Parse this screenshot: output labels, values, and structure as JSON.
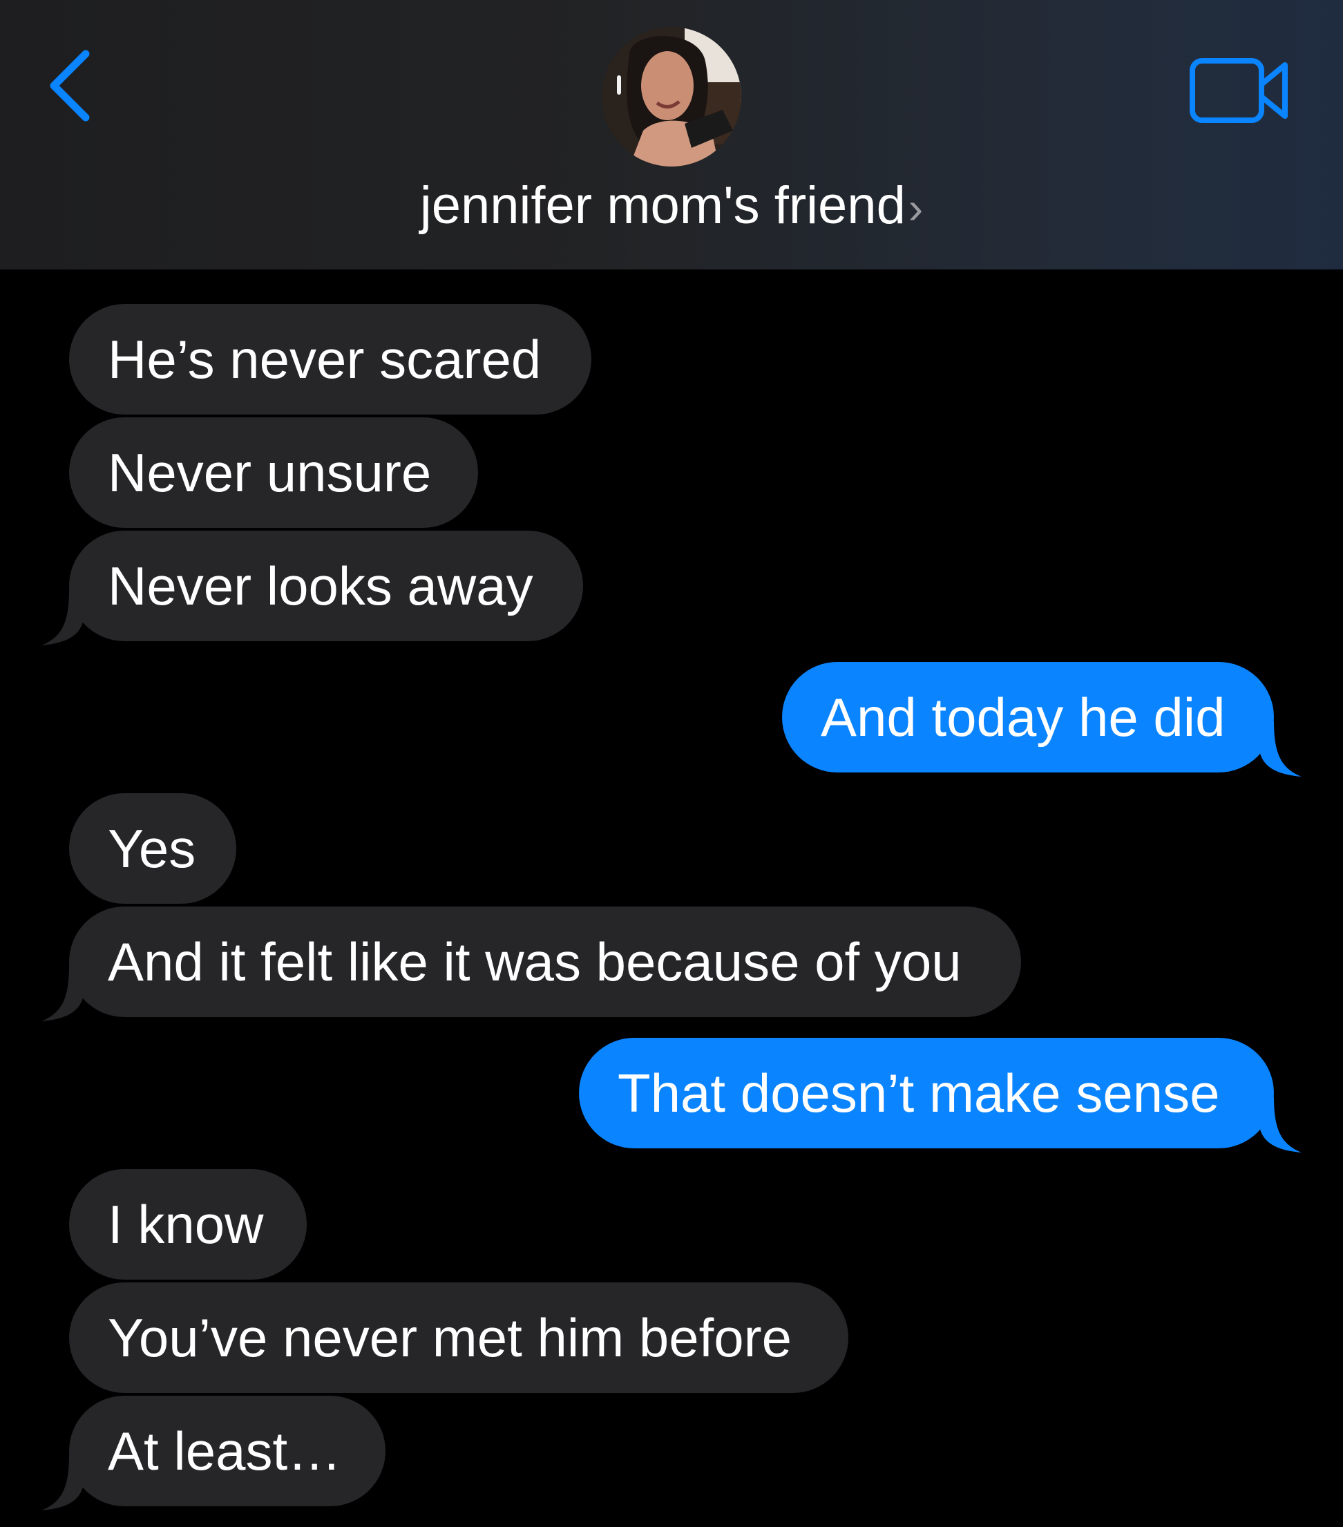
{
  "header": {
    "contact_name": "jennifer mom's friend",
    "chevron": "›",
    "back_icon": "chevron-left-icon",
    "video_icon": "video-camera-icon",
    "accent_color": "#0a84ff"
  },
  "messages": [
    {
      "sender": "them",
      "text": "He’s never scared"
    },
    {
      "sender": "them",
      "text": "Never unsure"
    },
    {
      "sender": "them",
      "text": "Never looks away"
    },
    {
      "sender": "me",
      "text": "And today he did"
    },
    {
      "sender": "them",
      "text": "Yes"
    },
    {
      "sender": "them",
      "text": "And it felt like it was because of you"
    },
    {
      "sender": "me",
      "text": "That doesn’t make sense"
    },
    {
      "sender": "them",
      "text": "I know"
    },
    {
      "sender": "them",
      "text": "You’ve never met him before"
    },
    {
      "sender": "them",
      "text": "At least…"
    }
  ],
  "colors": {
    "incoming_bubble": "#262629",
    "outgoing_bubble": "#0a84ff",
    "background": "#000000"
  }
}
